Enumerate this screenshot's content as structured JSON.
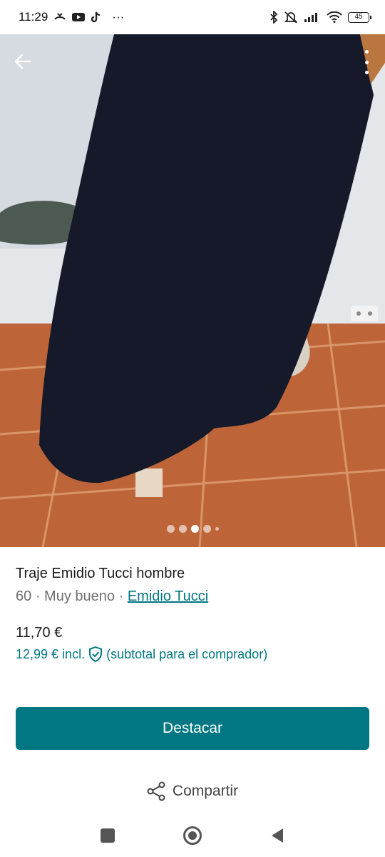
{
  "status_bar": {
    "time": "11:29",
    "battery": "45",
    "more": "···"
  },
  "listing": {
    "title": "Traje Emidio Tucci hombre",
    "size": "60",
    "separator": "·",
    "condition": "Muy bueno",
    "brand": "Emidio Tucci",
    "price": "11,70 €",
    "price_incl": "12,99 € incl.",
    "price_note": "(subtotal para el comprador)"
  },
  "carousel": {
    "count": 5,
    "active_index": 2
  },
  "actions": {
    "primary_label": "Destacar",
    "share_label": "Compartir"
  },
  "colors": {
    "accent": "#007782",
    "button_text": "#ffffff"
  },
  "icons": [
    "back-arrow-icon",
    "more-vertical-icon",
    "shield-check-icon",
    "share-icon",
    "recents-icon",
    "home-icon",
    "back-triangle-icon"
  ]
}
